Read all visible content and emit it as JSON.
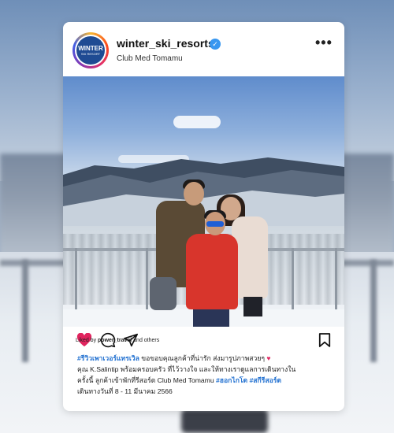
{
  "post": {
    "username": "winter_ski_resorts",
    "location": "Club Med Tomamu",
    "verified_icon": "✓",
    "more_icon": "•••",
    "avatar": {
      "line1": "WINTER",
      "line2": "SKI RESORT"
    },
    "liked_by_prefix": "Liked by ",
    "liked_by_user": "power_travel",
    "liked_by_suffix": " and others",
    "caption": {
      "hashtag1": "#รีวิวเพาเวอร์แทรเวิล",
      "line1_text": " ขอขอบคุณลูกค้าที่น่ารัก ส่งมารูปภาพสวยๆ ",
      "heart": "♥",
      "line2": "คุณ K.Salintip พร้อมครอบครัว ที่ไว้วางใจ และให้ทางเราดูแลการเดินทางใน",
      "line3_text": "ครั้งนี้ ลูกค้าเข้าพักที่รีสอร์ต Club Med Tomamu ",
      "hashtag2": "#ฮอกไกโด",
      "hashtag3": "#สกีรีสอร์ต",
      "line4": "เดินทางวันที่ 8 - 11 มีนาคม 2566"
    },
    "icons": {
      "like": "heart-icon",
      "comment": "comment-icon",
      "share": "share-icon",
      "save": "bookmark-icon"
    },
    "colors": {
      "like": "#e0245e",
      "hashtag": "#1f6fd0",
      "verified": "#3897f0"
    }
  }
}
